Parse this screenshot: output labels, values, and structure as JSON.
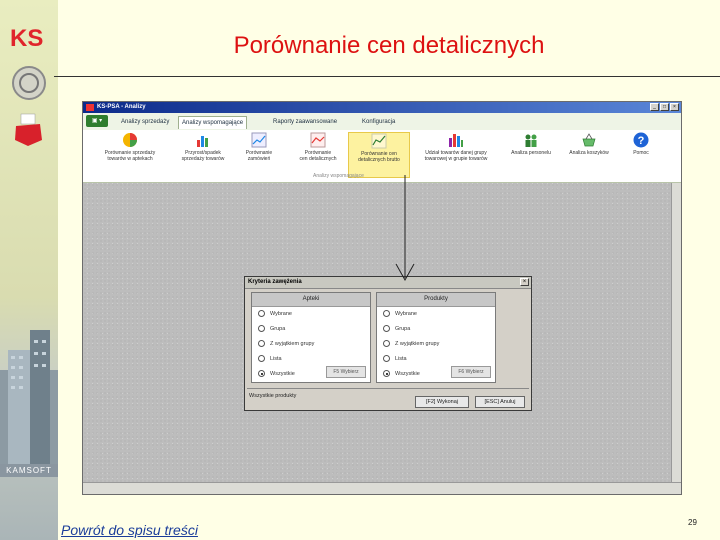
{
  "slide": {
    "title": "Porównanie cen detalicznych",
    "link_text": "Powrót do spisu treści",
    "page_number": "29"
  },
  "branding": {
    "brand_logo_text": "KS",
    "company": "KAMSOFT"
  },
  "app": {
    "title": "KS-PSA - Analizy",
    "window_buttons": [
      "_",
      "□",
      "×"
    ],
    "file_button": "▣ ▾",
    "tabs": [
      {
        "label": "Analizy sprzedaży",
        "active": false
      },
      {
        "label": "Analizy wspomagające",
        "active": true
      },
      {
        "label": "Raporty zaawansowane",
        "active": false
      },
      {
        "label": "Konfiguracja",
        "active": false
      }
    ],
    "ribbon": [
      {
        "label": "Porównanie sprzedaży\ntowarów w aptekach",
        "icon": "pie-chart-icon",
        "active": false
      },
      {
        "label": "Przyrost/spadek\nsprzedaży towarów",
        "icon": "bar-chart-icon",
        "active": false
      },
      {
        "label": "Porównanie\nzamówień",
        "icon": "line-chart-icon",
        "active": false
      },
      {
        "label": "Porównanie\ncen detalicznych",
        "icon": "line-chart-icon",
        "active": false
      },
      {
        "label": "Porównanie cen\ndetalicznych brutto",
        "icon": "prices-chart-icon",
        "active": true
      },
      {
        "label": "Udział towarów danej grupy\ntowarowej w grupie towarów",
        "icon": "multi-bar-chart-icon",
        "active": false
      },
      {
        "label": "Analiza personelu",
        "icon": "people-icon",
        "active": false
      },
      {
        "label": "Analiza koszyków",
        "icon": "basket-icon",
        "active": false
      },
      {
        "label": "Pomoc",
        "icon": "help-icon",
        "active": false
      }
    ],
    "ribbon_group_caption": "Analizy wspomagające"
  },
  "dialog": {
    "title": "Kryteria zawężenia",
    "close": "×",
    "left_panel": {
      "header": "Apteki",
      "options": [
        "Wybrane",
        "Grupa",
        "Z wyjątkiem grupy",
        "Lista",
        "Wszystkie"
      ],
      "selected": 4,
      "button": "F5 Wybierz"
    },
    "right_panel": {
      "header": "Produkty",
      "options": [
        "Wybrane",
        "Grupa",
        "Z wyjątkiem grupy",
        "Lista",
        "Wszystkie"
      ],
      "selected": 4,
      "button": "F6 Wybierz"
    },
    "status": "Wszystkie produkty",
    "ok_button": "[F2] Wykonaj",
    "cancel_button": "[ESC] Anuluj"
  }
}
